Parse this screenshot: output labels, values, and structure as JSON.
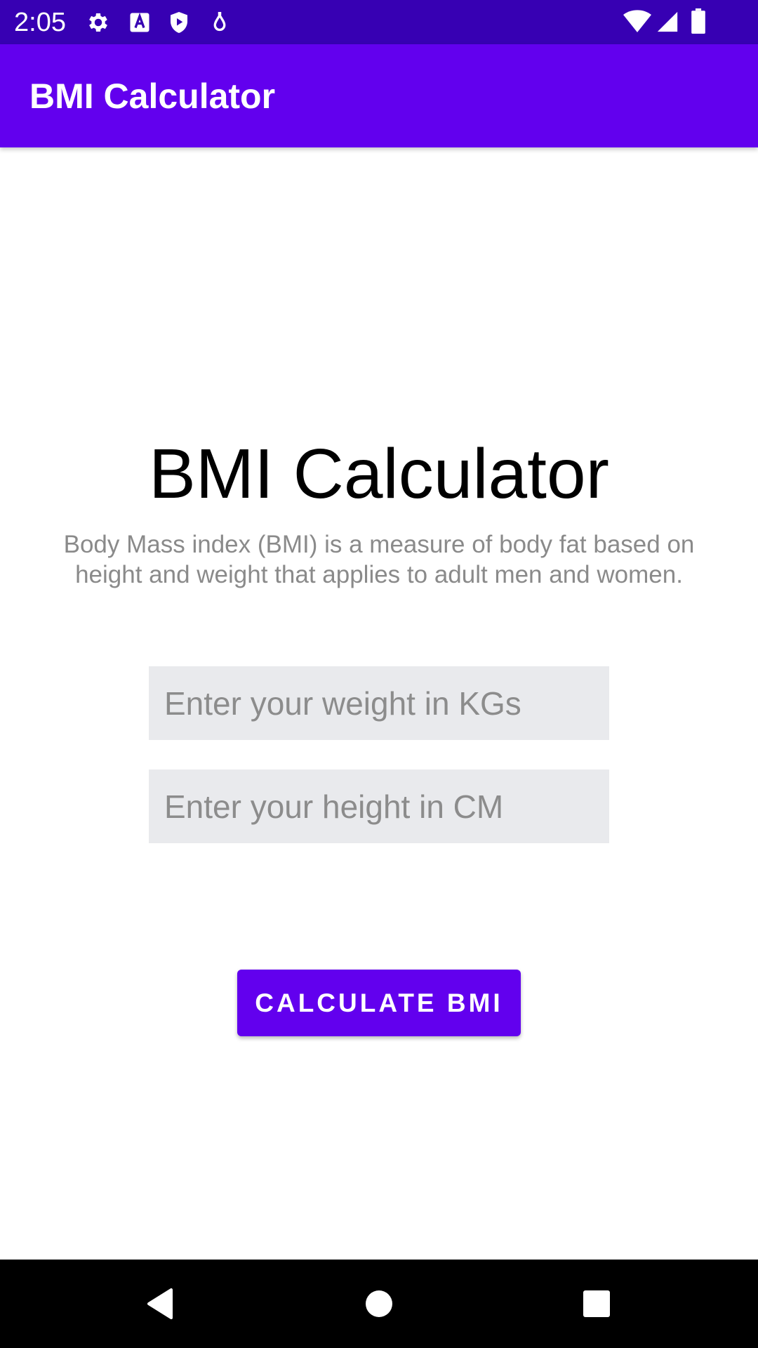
{
  "status_bar": {
    "time": "2:05",
    "icons": [
      "gear-icon",
      "a-icon",
      "shield-play-icon",
      "drop-icon",
      "wifi-icon",
      "signal-icon",
      "battery-icon"
    ]
  },
  "app_bar": {
    "title": "BMI Calculator",
    "color": "#6200ee"
  },
  "main": {
    "title": "BMI Calculator",
    "description": "Body Mass index (BMI) is a measure of body fat based on height and weight that applies to adult men and women.",
    "weight_placeholder": "Enter your weight in KGs",
    "height_placeholder": "Enter your height in CM",
    "button_label": "CALCULATE BMI"
  },
  "nav_bar": {
    "icons": [
      "back-icon",
      "home-icon",
      "recent-apps-icon"
    ]
  },
  "colors": {
    "status_bar": "#3700b3",
    "primary": "#6200ee",
    "input_background": "#e9eaed",
    "description_text": "#8a8a8a"
  }
}
